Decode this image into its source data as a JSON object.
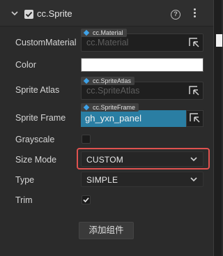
{
  "component": {
    "title": "cc.Sprite",
    "enabled": true
  },
  "fields": {
    "custom_material": {
      "label": "CustomMaterial",
      "type_tag": "cc.Material",
      "value": "cc.Material"
    },
    "color": {
      "label": "Color",
      "value": "#ffffff"
    },
    "sprite_atlas": {
      "label": "Sprite Atlas",
      "type_tag": "cc.SpriteAtlas",
      "value": "cc.SpriteAtlas"
    },
    "sprite_frame": {
      "label": "Sprite Frame",
      "type_tag": "cc.SpriteFrame",
      "value": "gh_yxn_panel"
    },
    "grayscale": {
      "label": "Grayscale",
      "checked": false
    },
    "size_mode": {
      "label": "Size Mode",
      "value": "CUSTOM"
    },
    "type": {
      "label": "Type",
      "value": "SIMPLE"
    },
    "trim": {
      "label": "Trim",
      "checked": true
    }
  },
  "actions": {
    "add_component": "添加组件"
  },
  "icons": {
    "collapse": "chevron-down-icon",
    "help": "help-icon",
    "more": "more-vertical-icon",
    "asset_pick": "locate-asset-icon",
    "asset_type": "asset-diamond-icon"
  },
  "colors": {
    "accent_selected": "#2a7ea3",
    "highlight": "#e0524f",
    "asset_tag_diamond": "#3ea2e8"
  }
}
